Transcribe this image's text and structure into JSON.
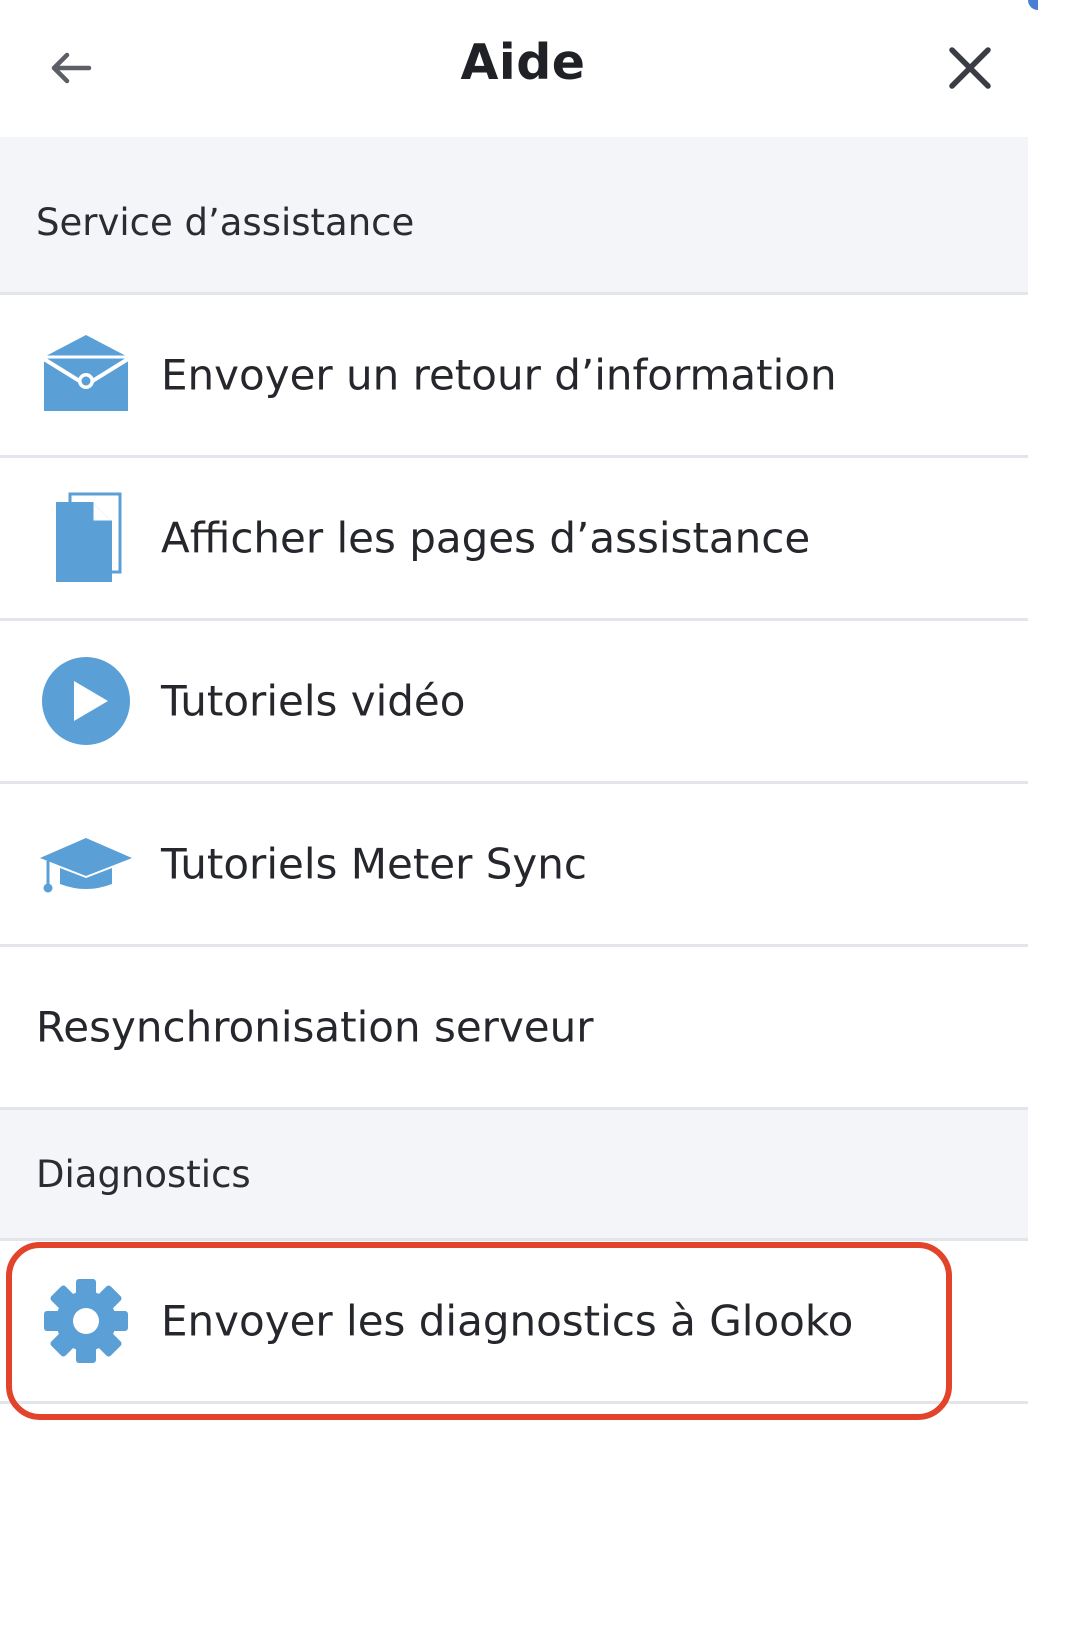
{
  "header": {
    "title": "Aide",
    "back_icon": "arrow-left-icon",
    "close_icon": "close-icon"
  },
  "sections": {
    "support": {
      "title": "Service d’assistance",
      "items": [
        {
          "label": "Envoyer un retour d’information",
          "icon": "envelope-icon"
        },
        {
          "label": "Afficher les pages d’assistance",
          "icon": "document-icon"
        },
        {
          "label": "Tutoriels vidéo",
          "icon": "play-icon"
        },
        {
          "label": "Tutoriels Meter Sync",
          "icon": "graduation-cap-icon"
        },
        {
          "label": "Resynchronisation serveur",
          "icon": ""
        }
      ]
    },
    "diagnostics": {
      "title": "Diagnostics",
      "items": [
        {
          "label": "Envoyer les diagnostics à Glooko",
          "icon": "gear-icon"
        }
      ]
    }
  },
  "colors": {
    "icon_blue": "#5b9fd7",
    "highlight_red": "#e2432b",
    "section_bg": "#f4f5f9",
    "divider": "#e3e5ea"
  }
}
